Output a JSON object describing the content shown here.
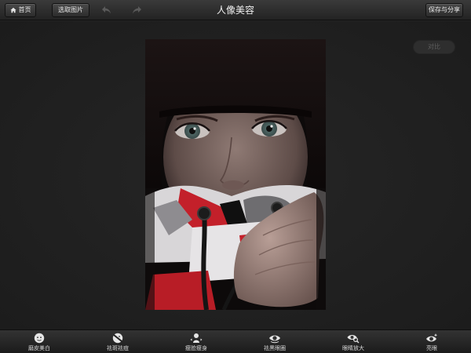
{
  "header": {
    "title": "人像美容",
    "home_label": "首页",
    "pick_label": "选取图片",
    "save_label": "保存与分享"
  },
  "canvas": {
    "compare_label": "对比"
  },
  "toolbar": {
    "items": [
      {
        "label": "磨皮美白",
        "icon": "face-smooth-icon"
      },
      {
        "label": "祛斑祛痘",
        "icon": "blemish-icon"
      },
      {
        "label": "瘦脸瘦身",
        "icon": "slim-icon"
      },
      {
        "label": "祛黑眼圈",
        "icon": "eye-circle-icon"
      },
      {
        "label": "眼睛放大",
        "icon": "eye-enlarge-icon"
      },
      {
        "label": "亮眼",
        "icon": "bright-eye-icon"
      }
    ]
  },
  "colors": {
    "background": "#222222",
    "bar": "#2b2b2b",
    "text": "#e8e8e8"
  }
}
